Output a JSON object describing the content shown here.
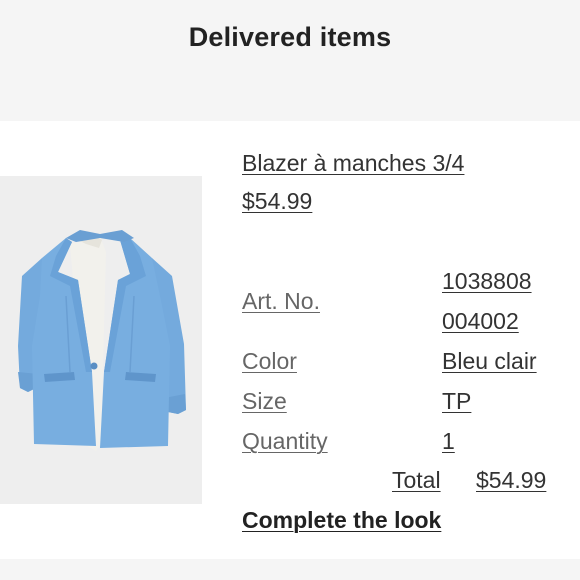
{
  "header": {
    "title": "Delivered items"
  },
  "item": {
    "name": "Blazer à manches 3/4",
    "price": "$54.99",
    "image_icon": "blazer-product-image",
    "details": {
      "art_no_label": "Art. No.",
      "art_no_line1": "1038808",
      "art_no_line2": "004002",
      "color_label": "Color",
      "color_value": "Bleu clair",
      "size_label": "Size",
      "size_value": "TP",
      "quantity_label": "Quantity",
      "quantity_value": "1"
    },
    "total_label": "Total",
    "total_value": "$54.99",
    "complete_look": "Complete the look"
  },
  "colors": {
    "blazer": "#78aee0",
    "lining": "#f2f1ec",
    "background": "#f5f5f5",
    "card": "#ffffff"
  }
}
